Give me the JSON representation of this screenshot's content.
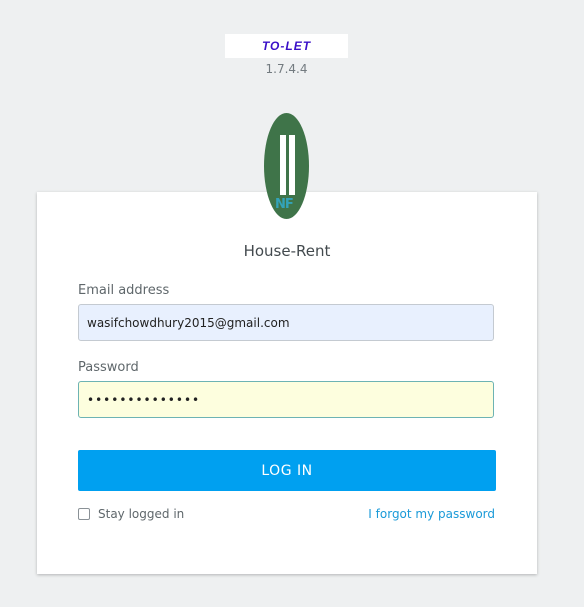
{
  "logo": {
    "text": "TO-LET"
  },
  "version": "1.7.4.4",
  "avatar": {
    "mark_text": "NF",
    "icon": "profile-avatar-icon"
  },
  "app_name": "House-Rent",
  "email": {
    "label": "Email address",
    "value": "wasifchowdhury2015@gmail.com"
  },
  "password": {
    "label": "Password",
    "masked_value": "••••••••••••••"
  },
  "login_button": "LOG IN",
  "stay_logged_in": {
    "label": "Stay logged in",
    "checked": false
  },
  "forgot_link": "I forgot my password",
  "colors": {
    "accent": "#00a0f0",
    "link": "#1a9ad8",
    "logo": "#3a10c8",
    "avatar": "#3f7449",
    "email_field_bg": "#e8f0fe",
    "password_field_bg": "#fdfede"
  }
}
